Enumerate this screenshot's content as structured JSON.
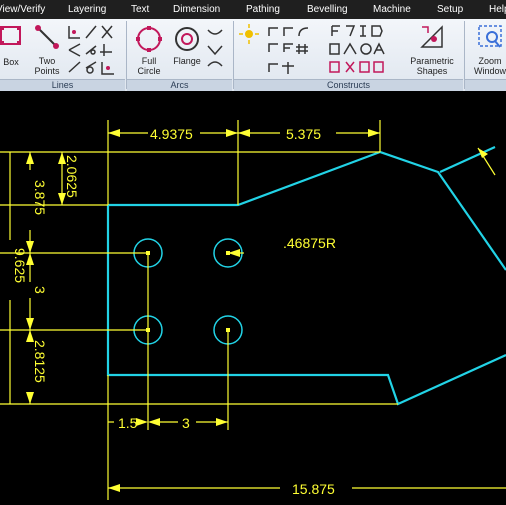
{
  "menu": {
    "items": [
      "View/Verify",
      "Layering",
      "Text",
      "Dimension",
      "Pathing",
      "Bevelling",
      "Machine",
      "Setup",
      "Help"
    ]
  },
  "ribbon": {
    "groups": {
      "lines": "Lines",
      "arcs": "Arcs",
      "constructs": "Constructs"
    },
    "tools": {
      "box": "Box",
      "two_points_1": "Two",
      "two_points_2": "Points",
      "full_circle_1": "Full",
      "full_circle_2": "Circle",
      "flange": "Flange",
      "parametric_1": "Parametric",
      "parametric_2": "Shapes",
      "zoom_1": "Zoom",
      "zoom_2": "Window"
    }
  },
  "drawing": {
    "dimensions": {
      "top_left": "4.9375",
      "top_right": "5.375",
      "hole_radius": ".46875R",
      "left_top": "2.0625",
      "left_mid_upper": "3.875",
      "left_mid": "3",
      "left_bottom": "2.8125",
      "left_overall": "9.625",
      "bottom_1": "1.5",
      "bottom_2": "3",
      "overall_width": "15.875"
    },
    "colors": {
      "part": "#22d3e6",
      "dimension": "#ffff33",
      "background": "#000000"
    }
  }
}
